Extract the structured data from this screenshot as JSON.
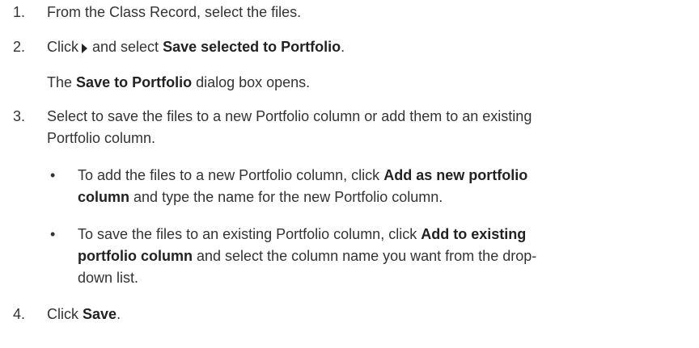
{
  "steps": [
    {
      "number": "1.",
      "text": "From the Class Record, select the files."
    },
    {
      "number": "2.",
      "before": "Click",
      "icon": "play-arrow-icon",
      "middle": "and select",
      "bold": "Save selected to Portfolio",
      "after": ".",
      "note": {
        "before": "The",
        "bold": "Save to Portfolio",
        "after": "dialog box opens."
      }
    },
    {
      "number": "3.",
      "line1": "Select to save the files to a new Portfolio column or add them to an existing",
      "line2": "Portfolio column.",
      "bullets": [
        {
          "symbol": "•",
          "l1_before": "To add the files to a new Portfolio column, click",
          "l1_bold": "Add as new portfolio",
          "l2_bold": "column",
          "l2_after": "and type the name for the new Portfolio column."
        },
        {
          "symbol": "•",
          "l1_before": "To save the files to an existing Portfolio column, click",
          "l1_bold": "Add to existing",
          "l2_bold": "portfolio column",
          "l2_after": "and select the column name you want from the drop-",
          "l3": "down list."
        }
      ]
    },
    {
      "number": "4.",
      "before": "Click",
      "bold": "Save",
      "after": "."
    }
  ]
}
